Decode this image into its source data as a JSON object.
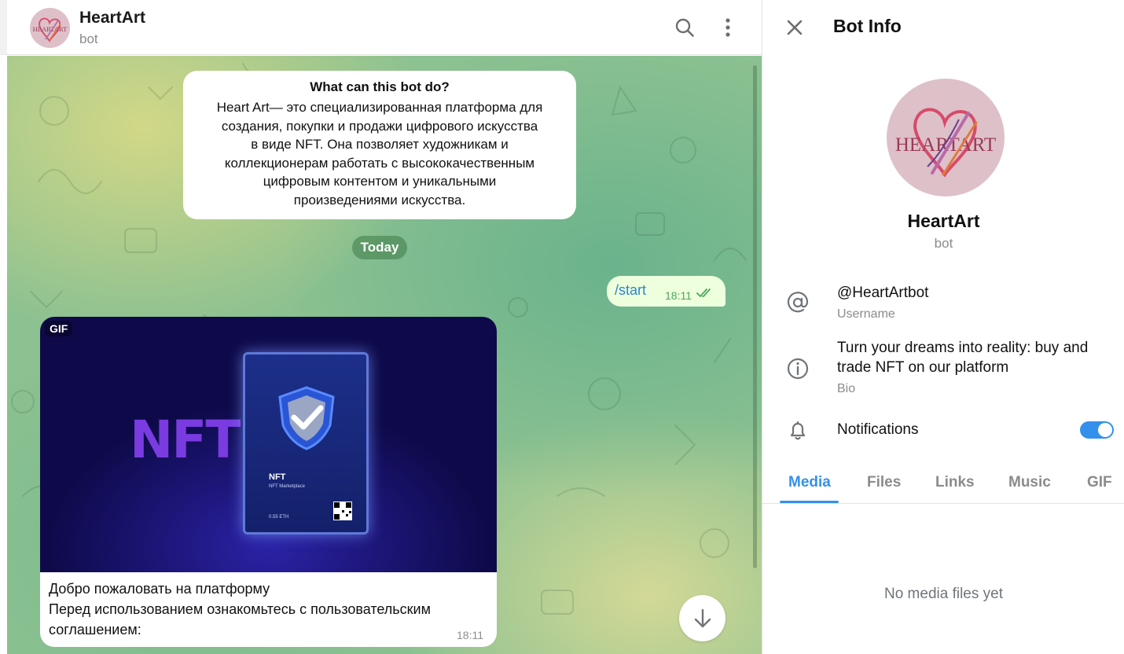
{
  "chat": {
    "title": "HeartArt",
    "subtitle": "bot",
    "avatar_text": "HEARTART",
    "bot_intro": {
      "title": "What can this bot do?",
      "text": "Heart Art— это специализированная платформа для\nсоздания, покупки и продажи цифрового искусства\nв виде NFT. Она позволяет художникам и\nколлекционерам работать с высококачественным\nцифровым контентом и уникальными\nпроизведениями искусства."
    },
    "date_label": "Today",
    "outgoing_message": {
      "text": "/start",
      "time": "18:11",
      "status_icon": "double-check-icon"
    },
    "incoming_message": {
      "media_badge": "GIF",
      "gif": {
        "big_text": "NFT",
        "card_title": "NFT",
        "card_subtitle": "NFT Marketplace",
        "card_price": "0.55 ETH"
      },
      "caption": "Добро пожаловать на платформу\nПеред использованием ознакомьтесь с пользовательским\nсоглашением:",
      "time": "18:11"
    },
    "icons": [
      "search-icon",
      "more-vertical-icon",
      "arrow-down-icon"
    ]
  },
  "info_panel": {
    "title": "Bot Info",
    "name": "HeartArt",
    "subtitle": "bot",
    "avatar_text": "HEARTART",
    "username": {
      "value": "@HeartArtbot",
      "label": "Username",
      "icon": "at-icon"
    },
    "bio": {
      "value": "Turn your dreams into reality: buy and trade NFT on our platform",
      "label": "Bio",
      "icon": "info-icon"
    },
    "notifications": {
      "label": "Notifications",
      "enabled": true,
      "icon": "bell-icon"
    },
    "tabs": [
      {
        "label": "Media",
        "active": true
      },
      {
        "label": "Files",
        "active": false
      },
      {
        "label": "Links",
        "active": false
      },
      {
        "label": "Music",
        "active": false
      },
      {
        "label": "GIF",
        "active": false
      }
    ],
    "empty_state": "No media files yet"
  },
  "colors": {
    "accent": "#3390ec",
    "outgoing_bubble": "#eeffde",
    "date_pill": "#5f9a68"
  }
}
